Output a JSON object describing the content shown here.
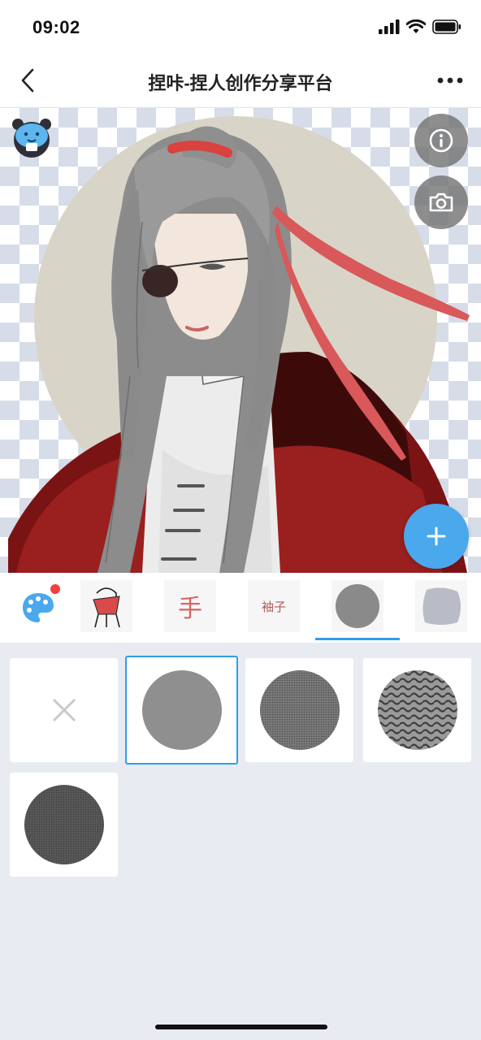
{
  "status_bar": {
    "time": "09:02"
  },
  "nav": {
    "title": "捏咔-捏人创作分享平台"
  },
  "categories": [
    {
      "label": ""
    },
    {
      "label": "手"
    },
    {
      "label": "袖子"
    },
    {
      "label": ""
    },
    {
      "label": ""
    }
  ],
  "selected_category_index": 3,
  "options": [
    {
      "name": "none",
      "fill": ""
    },
    {
      "name": "solid-gray",
      "fill": "#8f8f8f"
    },
    {
      "name": "dotted-dark",
      "fill": "#6d6d6d"
    },
    {
      "name": "wave-pattern",
      "fill": "#7a7a7a"
    },
    {
      "name": "solid-dark",
      "fill": "#555555"
    }
  ],
  "selected_option_index": 1,
  "colors": {
    "accent": "#4aa8ec",
    "tab_underline": "#2f9de8",
    "notification_dot": "#f1413b",
    "grid_background": "#e8ecf2"
  }
}
